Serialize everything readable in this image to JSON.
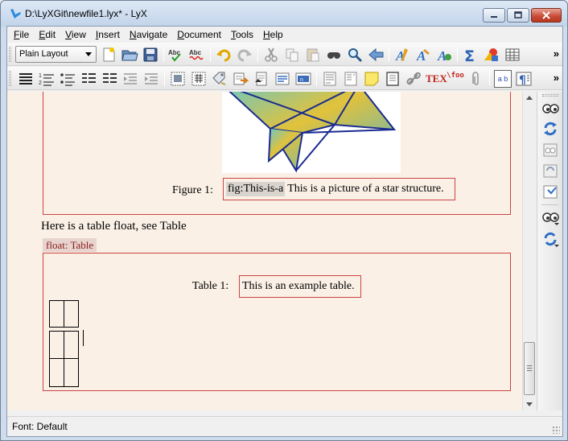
{
  "window": {
    "title": "D:\\LyXGit\\newfile1.lyx* - LyX",
    "icons": [
      "lyx-app-icon",
      "minimize-icon",
      "maximize-icon",
      "close-icon"
    ]
  },
  "menubar": {
    "items": [
      {
        "label": "File",
        "mnemonic": "F"
      },
      {
        "label": "Edit",
        "mnemonic": "E"
      },
      {
        "label": "View",
        "mnemonic": "V"
      },
      {
        "label": "Insert",
        "mnemonic": "I"
      },
      {
        "label": "Navigate",
        "mnemonic": "N"
      },
      {
        "label": "Document",
        "mnemonic": "D"
      },
      {
        "label": "Tools",
        "mnemonic": "T"
      },
      {
        "label": "Help",
        "mnemonic": "H"
      }
    ]
  },
  "toolbar1": {
    "layout_combo": "Plain Layout",
    "overflow": "»",
    "icons": [
      "new-document-icon",
      "open-folder-icon",
      "save-icon",
      "spellcheck-icon",
      "spellcheck-continuous-icon",
      "undo-icon",
      "redo-icon",
      "cut-icon",
      "copy-icon",
      "paste-icon",
      "find-replace-icon",
      "search-icon",
      "navigate-back-icon",
      "text-style-icon",
      "emphasis-icon",
      "font-change-icon",
      "math-icon",
      "insert-graphics-icon",
      "insert-table-icon"
    ]
  },
  "toolbar2": {
    "overflow": "»",
    "tex_label": "TEX",
    "foo_label": "\\foo",
    "ab_label": "a b",
    "icons": [
      "itemize-icon",
      "enumerate-icon",
      "description-icon",
      "list-indent-icon",
      "list-outdent-icon",
      "depth-decrease-icon",
      "depth-increase-icon",
      "insert-figure-float-icon",
      "insert-table-float-icon",
      "insert-label-icon",
      "insert-cross-reference-icon",
      "insert-citation-icon",
      "insert-index-icon",
      "insert-nomenclature-icon",
      "insert-footnote-icon",
      "insert-margin-note-icon",
      "insert-note-icon",
      "insert-box-icon",
      "insert-hyperlink-icon",
      "insert-tex-code-icon",
      "insert-macro-icon",
      "insert-file-icon",
      "insert-cross-reference-ab-icon",
      "paragraph-settings-icon"
    ]
  },
  "document": {
    "figure_label": "Figure 1:",
    "figure_label_inset": "fig:This-is-a",
    "figure_caption": "This is a picture of a star structure.",
    "body_text": "Here is a table float, see Table",
    "float_tag": "float: Table",
    "table_label": "Table 1:",
    "table_caption": "This is an example table."
  },
  "side_toolbar": {
    "icons": [
      "view-icon",
      "update-icon",
      "view-master-icon",
      "update-master-icon",
      "export-icon",
      "view-other-icon",
      "update-other-icon"
    ]
  },
  "statusbar": {
    "text": "Font: Default"
  },
  "colors": {
    "doc_background": "#faf0e6",
    "inset_frame": "#cc4444",
    "float_tag_text": "#8b1a1a",
    "star_stroke": "#1a2b8f"
  }
}
